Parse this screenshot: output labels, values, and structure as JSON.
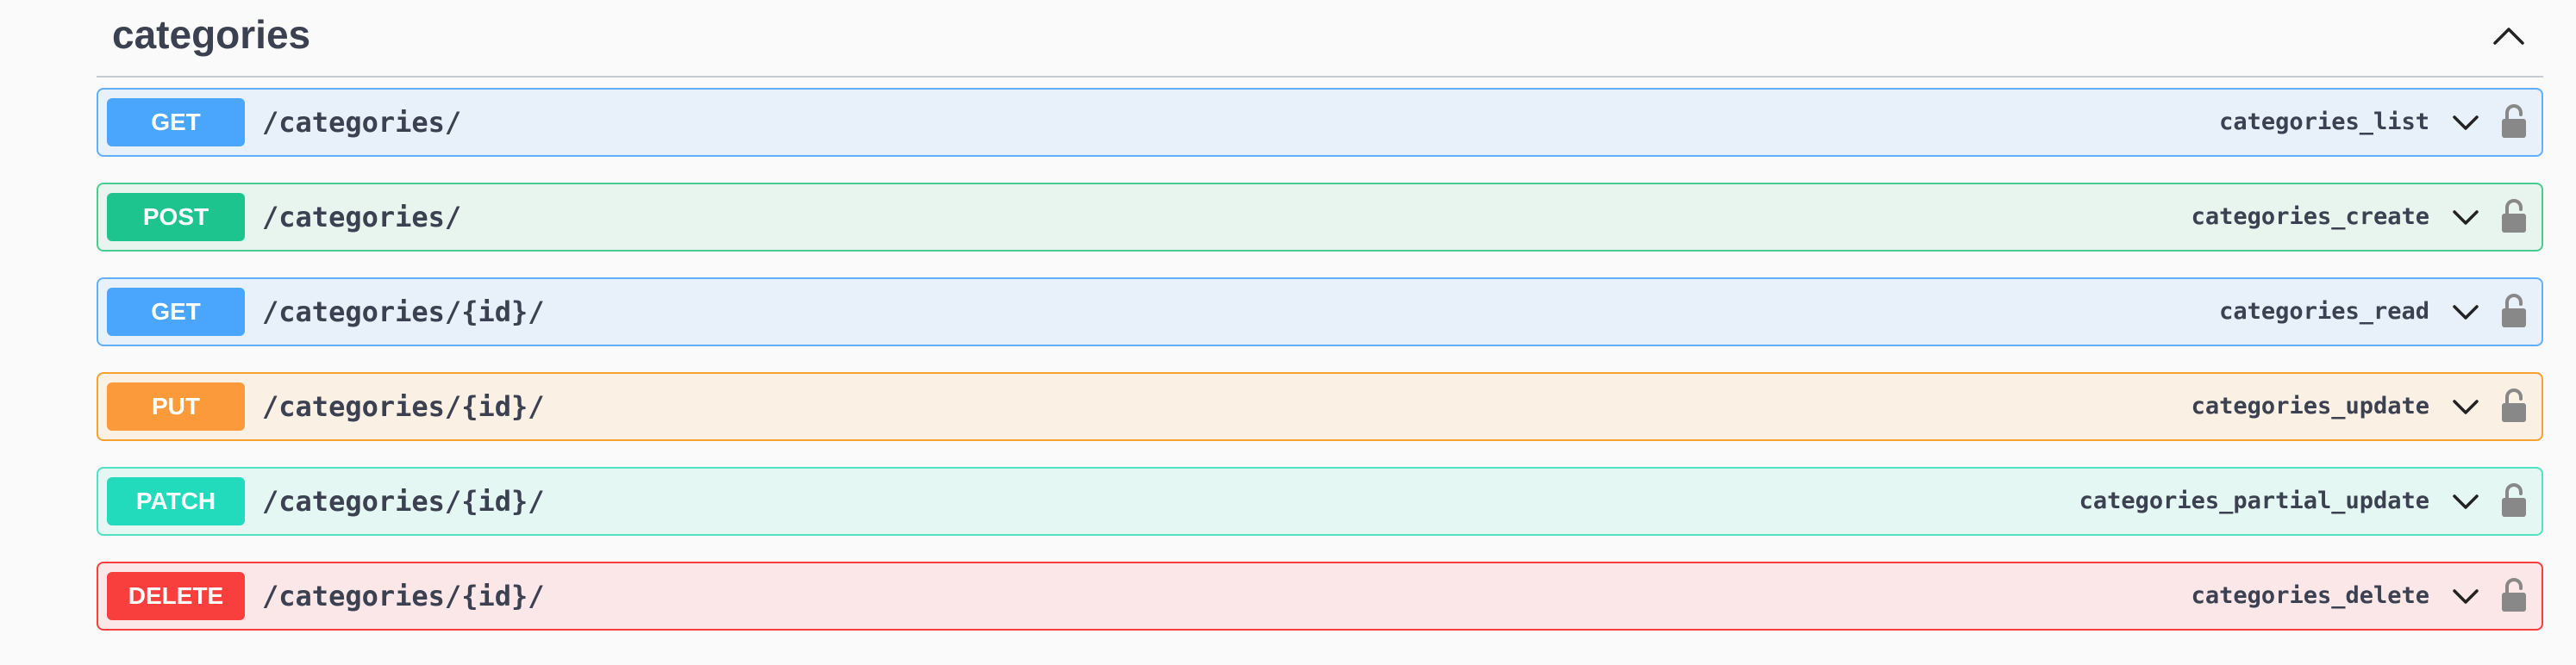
{
  "section": {
    "title": "categories"
  },
  "operations": [
    {
      "method": "GET",
      "path": "/categories/",
      "operation_id": "categories_list",
      "color": "#49a6fc",
      "bg": "#e8f1fa",
      "border": "#61affe"
    },
    {
      "method": "POST",
      "path": "/categories/",
      "operation_id": "categories_create",
      "color": "#1ec48e",
      "bg": "#e7f5ee",
      "border": "#49cc90"
    },
    {
      "method": "GET",
      "path": "/categories/{id}/",
      "operation_id": "categories_read",
      "color": "#49a6fc",
      "bg": "#e8f1fa",
      "border": "#61affe"
    },
    {
      "method": "PUT",
      "path": "/categories/{id}/",
      "operation_id": "categories_update",
      "color": "#fb9a3a",
      "bg": "#fbf0e4",
      "border": "#fca130"
    },
    {
      "method": "PATCH",
      "path": "/categories/{id}/",
      "operation_id": "categories_partial_update",
      "color": "#22dbbd",
      "bg": "#e5f7f3",
      "border": "#50e3c2"
    },
    {
      "method": "DELETE",
      "path": "/categories/{id}/",
      "operation_id": "categories_delete",
      "color": "#f93e3e",
      "bg": "#fbe7e7",
      "border": "#f93e3e"
    }
  ],
  "icons": {
    "collapse": "chevron-up-icon",
    "expand": "chevron-down-icon",
    "auth": "unlocked-icon"
  }
}
